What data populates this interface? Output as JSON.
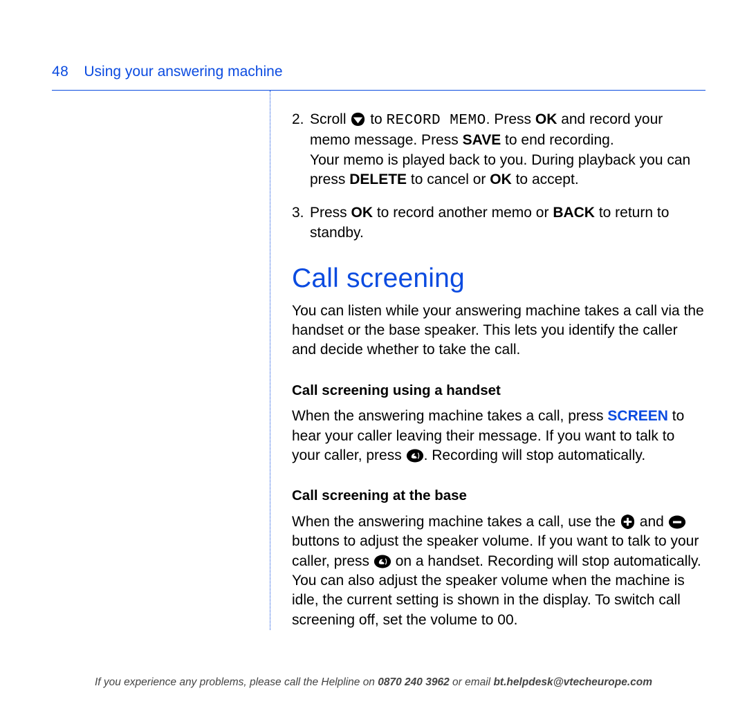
{
  "header": {
    "page_number": "48",
    "section": "Using your answering machine"
  },
  "steps": [
    {
      "num": "2.",
      "pre_icon": "Scroll ",
      "icon": "down-arrow",
      "post_icon_1": " to ",
      "mono": "RECORD MEMO",
      "post_mono": ". Press ",
      "b1": "OK",
      "after_b1": " and record your memo message. Press ",
      "b2": "SAVE",
      "after_b2": " to end recording.",
      "line2_pre": "Your memo is played back to you. During playback you can press ",
      "b3": "DELETE",
      "mid": " to cancel or ",
      "b4": "OK",
      "after_b4": " to accept."
    },
    {
      "num": "3.",
      "pre": "Press ",
      "b1": "OK",
      "mid": " to record another memo or ",
      "b2": "BACK",
      "post": " to return to standby."
    }
  ],
  "section_heading": "Call screening",
  "intro": "You can listen while your answering machine takes a call via the handset or the base speaker. This lets you identify the caller and decide whether to take the call.",
  "sub1": {
    "title": "Call screening using a handset",
    "p_pre": "When the answering machine takes a call, press ",
    "b1": "SCREEN",
    "p_mid": " to hear your caller leaving their message. If you want to talk to your caller, press ",
    "p_post": ". Recording will stop automatically."
  },
  "sub2": {
    "title": "Call screening at the base",
    "p_pre": "When the answering machine takes a call, use the ",
    "p_mid1": " and ",
    "p_mid2": " buttons to adjust the speaker volume. If you want to talk to your caller, press ",
    "p_mid3": " on a handset. Recording will stop automatically. You can also adjust the speaker volume when the machine is idle, the current setting is shown in the display. To switch call screening off, set the volume to 00."
  },
  "footer": {
    "pre": "If you experience any problems, please call the Helpline on ",
    "phone": "0870 240 3962",
    "mid": " or email ",
    "email": "bt.helpdesk@vtecheurope.com"
  }
}
